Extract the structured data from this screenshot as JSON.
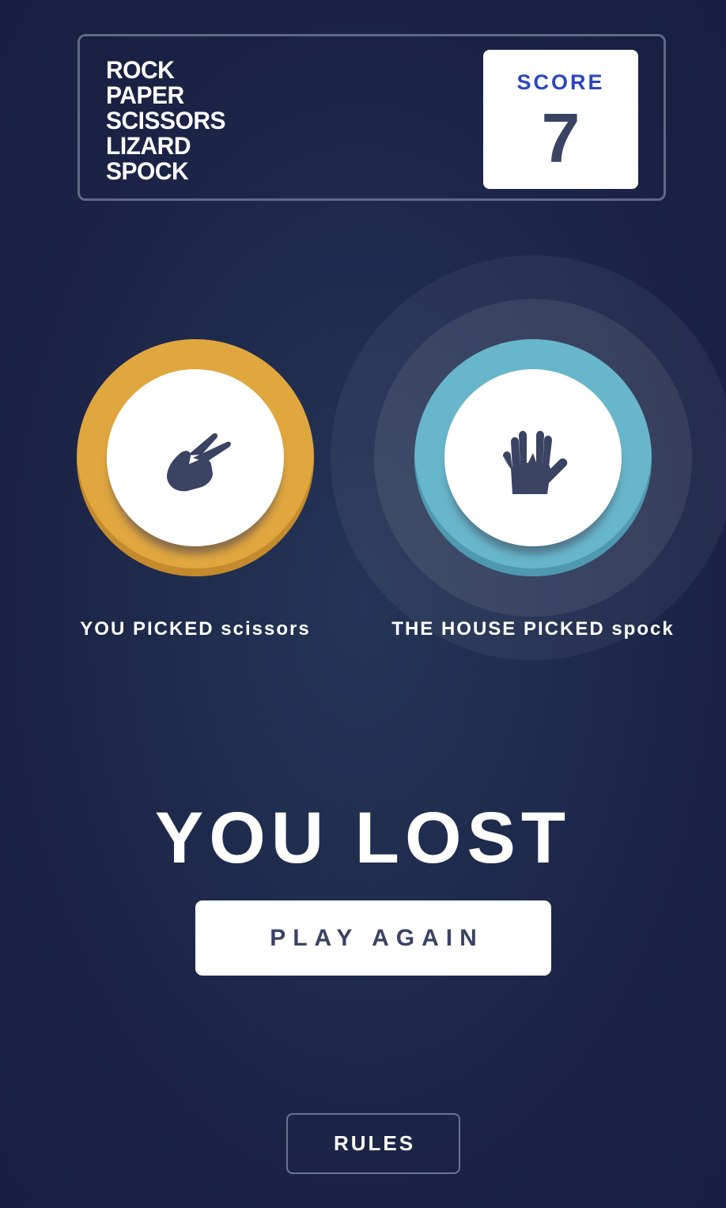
{
  "header": {
    "title_lines": [
      "ROCK",
      "PAPER",
      "SCISSORS",
      "LIZARD",
      "SPOCK"
    ],
    "score_label": "SCORE",
    "score_value": "7"
  },
  "player": {
    "label": "YOU PICKED scissors",
    "choice": "scissors",
    "icon": "scissors-hand-icon",
    "ring_color": "#e0a73f"
  },
  "house": {
    "label": "THE HOUSE PICKED spock",
    "choice": "spock",
    "icon": "spock-hand-icon",
    "ring_color": "#68b6cb"
  },
  "result": {
    "text": "YOU LOST"
  },
  "buttons": {
    "play_again": "PLAY AGAIN",
    "rules": "RULES"
  },
  "colors": {
    "background": "#1f2c4e",
    "icon_dark": "#3b4363",
    "score_accent": "#2a46c0"
  }
}
